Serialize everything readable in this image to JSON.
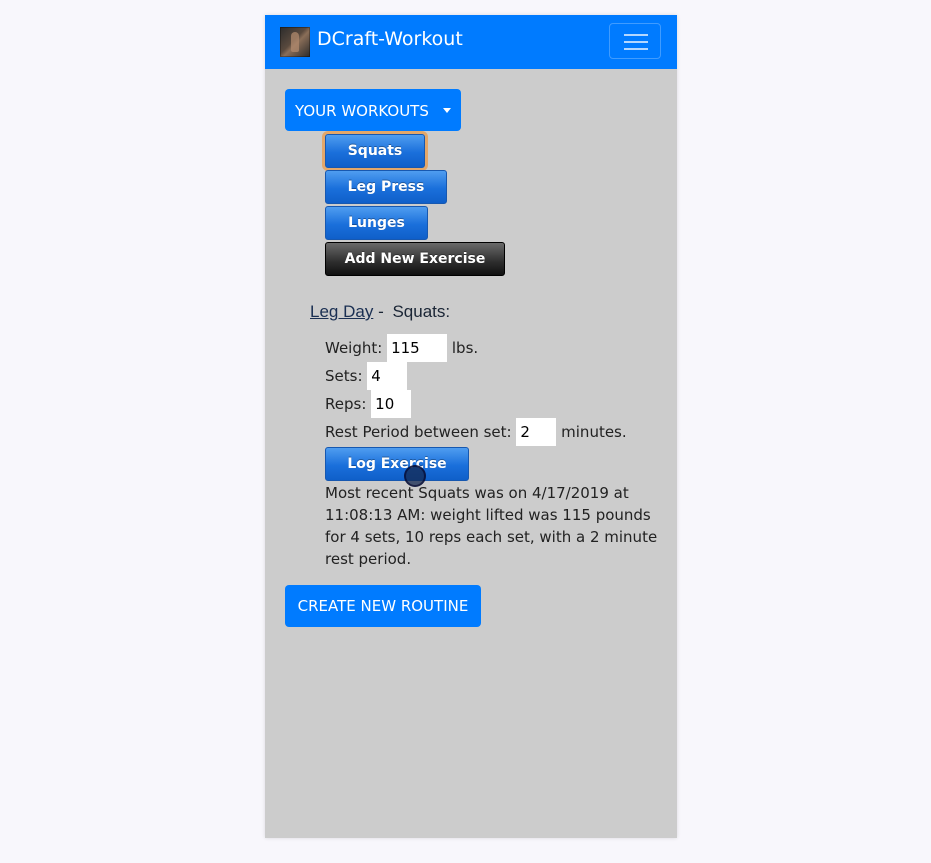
{
  "app": {
    "title": "DCraft-Workout"
  },
  "navbar": {
    "toggle_icon": "hamburger-menu-icon",
    "brand_color": "#007bff"
  },
  "workouts_dropdown": {
    "label": "YOUR WORKOUTS"
  },
  "exercises": [
    {
      "label": "Squats",
      "focused": true
    },
    {
      "label": "Leg Press"
    },
    {
      "label": "Lunges"
    }
  ],
  "add_exercise": {
    "label": "Add New Exercise"
  },
  "routine": {
    "name": "Leg Day",
    "separator": "-",
    "exercise": "Squats:"
  },
  "form": {
    "weight_label": "Weight:",
    "weight_value": "115",
    "weight_unit": "lbs.",
    "sets_label": "Sets:",
    "sets_value": "4",
    "reps_label": "Reps:",
    "reps_value": "10",
    "rest_label": "Rest Period between set:",
    "rest_value": "2",
    "rest_unit": "minutes.",
    "log_button": "Log Exercise"
  },
  "summary": "Most recent Squats was on 4/17/2019 at 11:08:13 AM: weight lifted was 115 pounds for 4 sets, 10 reps each set, with a 2 minute rest period.",
  "create_routine": {
    "label": "CREATE NEW ROUTINE"
  }
}
